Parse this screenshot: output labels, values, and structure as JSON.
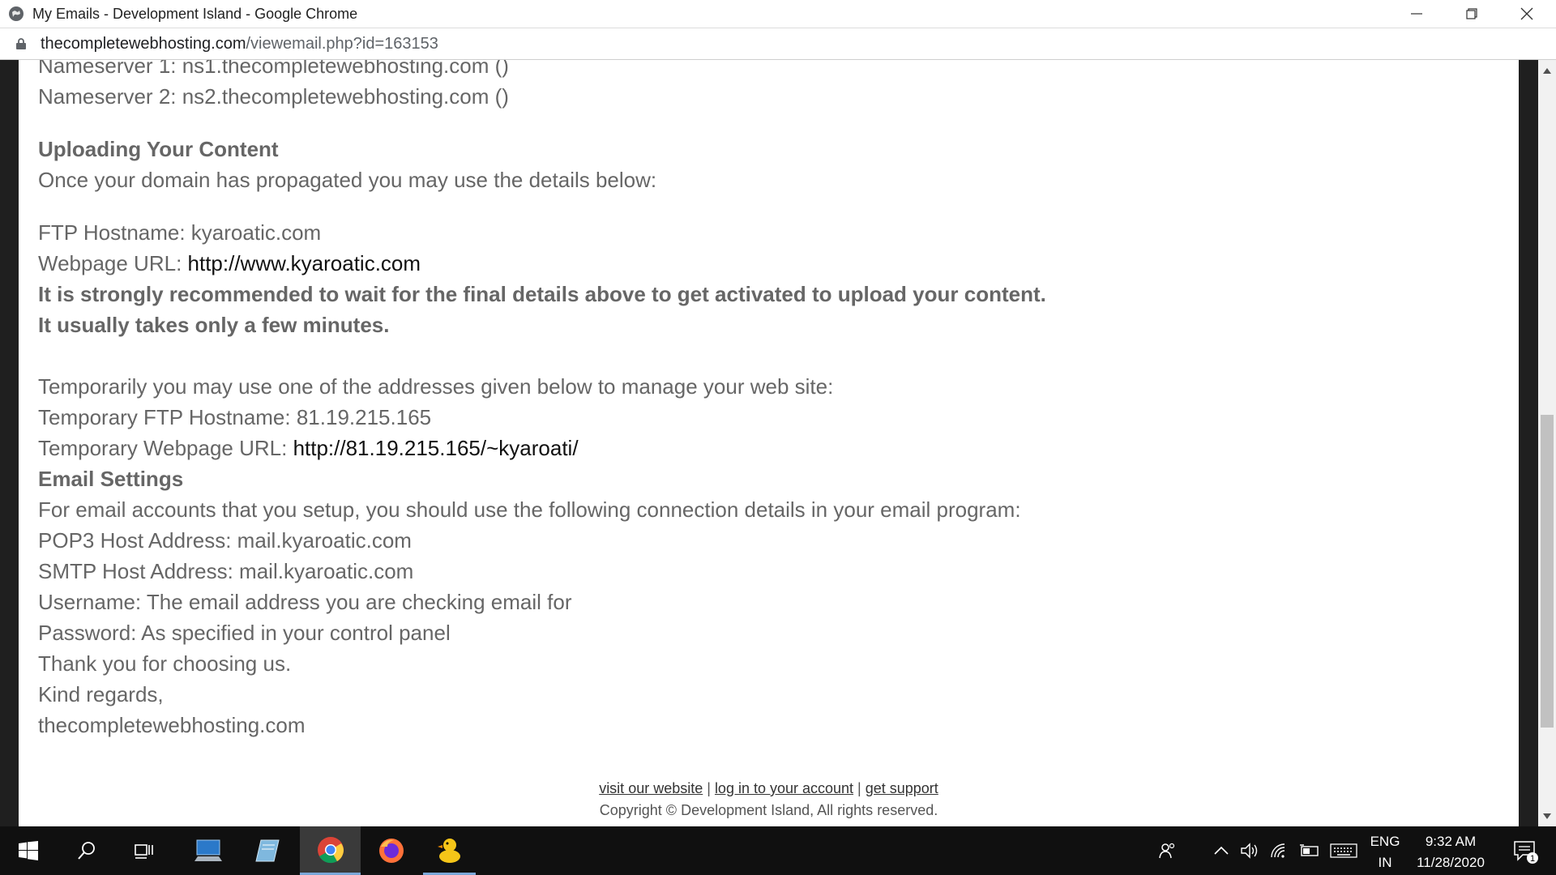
{
  "window": {
    "title": "My Emails - Development Island - Google Chrome"
  },
  "address": {
    "domain": "thecompletewebhosting.com",
    "path": "/viewemail.php?id=163153"
  },
  "email": {
    "ns1": "Nameserver 1: ns1.thecompletewebhosting.com ()",
    "ns2": "Nameserver 2: ns2.thecompletewebhosting.com ()",
    "upload_heading": "Uploading Your Content",
    "upload_intro": "Once your domain has propagated you may use the details below:",
    "ftp_hostname": "FTP Hostname: kyaroatic.com",
    "webpage_label": "Webpage URL: ",
    "webpage_url": "http://www.kyaroatic.com",
    "warning_1": "It is strongly recommended to wait for the final details above to get activated to upload your content.",
    "warning_2": "It usually takes only a few minutes.",
    "temp_intro": "Temporarily you may use one of the addresses given below to manage your web site:",
    "temp_ftp": "Temporary FTP Hostname: 81.19.215.165",
    "temp_web_label": "Temporary Webpage URL: ",
    "temp_web_url": "http://81.19.215.165/~kyaroati/",
    "email_heading": "Email Settings",
    "email_intro": "For email accounts that you setup, you should use the following connection details in your email program:",
    "pop3": "POP3 Host Address: mail.kyaroatic.com",
    "smtp": "SMTP Host Address: mail.kyaroatic.com",
    "username": "Username: The email address you are checking email for",
    "password": "Password: As specified in your control panel",
    "thanks": "Thank you for choosing us.",
    "regards": "Kind regards,",
    "signature": "thecompletewebhosting.com"
  },
  "footer": {
    "visit": "visit our website",
    "login": "log in to your account",
    "support": "get support",
    "sep": " | ",
    "copyright": "Copyright © Development Island, All rights reserved."
  },
  "taskbar": {
    "lang_top": "ENG",
    "lang_bottom": "IN",
    "time": "9:32 AM",
    "date": "11/28/2020",
    "notification_count": "1"
  }
}
